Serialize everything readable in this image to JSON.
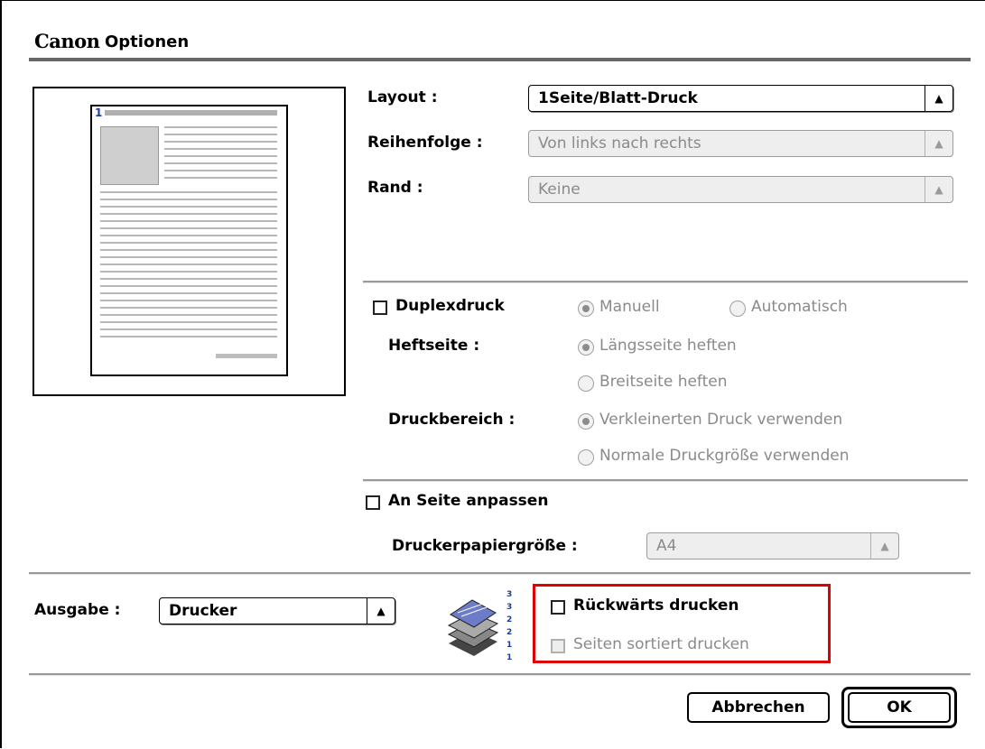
{
  "title": {
    "brand": "Canon",
    "text": "Optionen"
  },
  "preview": {
    "page_number": "1"
  },
  "layout": {
    "label": "Layout :",
    "value": "1Seite/Blatt-Druck"
  },
  "order": {
    "label": "Reihenfolge :",
    "value": "Von links nach rechts"
  },
  "border": {
    "label": "Rand :",
    "value": "Keine"
  },
  "duplex": {
    "label": "Duplexdruck",
    "checked": false,
    "mode_options": [
      "Manuell",
      "Automatisch"
    ],
    "mode_selected": "Manuell",
    "binding_label": "Heftseite :",
    "binding_options": [
      "Längsseite heften",
      "Breitseite heften"
    ],
    "binding_selected": "Längsseite heften",
    "area_label": "Druckbereich :",
    "area_options": [
      "Verkleinerten Druck verwenden",
      "Normale Druckgröße verwenden"
    ],
    "area_selected": "Verkleinerten Druck verwenden"
  },
  "fit": {
    "label": "An Seite anpassen",
    "checked": false,
    "paper_label": "Druckerpapiergröße :",
    "paper_value": "A4"
  },
  "output": {
    "label": "Ausgabe :",
    "value": "Drucker"
  },
  "reverse": {
    "label": "Rückwärts drucken",
    "checked": false
  },
  "collate": {
    "label": "Seiten sortiert drucken",
    "checked": false
  },
  "stack_icon": {
    "numbers": "3 3 2 2 1 1"
  },
  "buttons": {
    "cancel": "Abbrechen",
    "ok": "OK"
  },
  "colors": {
    "highlight": "#e00000",
    "rule": "#666666",
    "disabled_text": "#8a8a8a"
  }
}
